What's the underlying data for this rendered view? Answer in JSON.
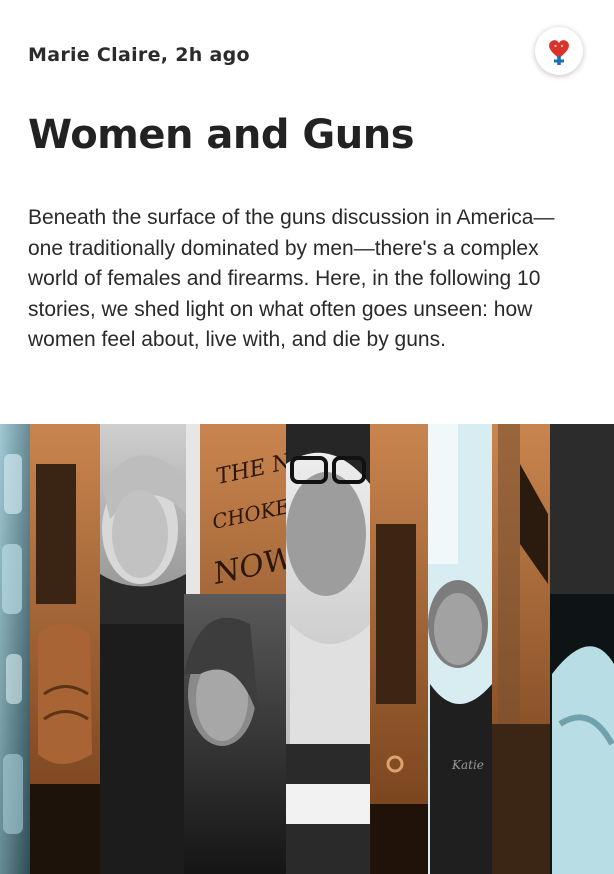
{
  "article": {
    "source": "Marie Claire",
    "separator": ",",
    "time_ago": "2h ago",
    "title": "Women and Guns",
    "description": "Beneath the surface of the guns discussion in America—one traditionally dominated by men—there's a complex world of females and firearms. Here, in the following 10 stories, we shed light on what often goes unseen: how women feel about, live with, and die by guns."
  },
  "badge": {
    "icon": "female-heart-icon",
    "color": "#d9322b",
    "accent": "#1b6fb5"
  },
  "hero_image": {
    "icon": "collage-image",
    "protest_sign_text": "THE NRA CHOKEHOLD NOW",
    "shirt_text": "Katie"
  }
}
